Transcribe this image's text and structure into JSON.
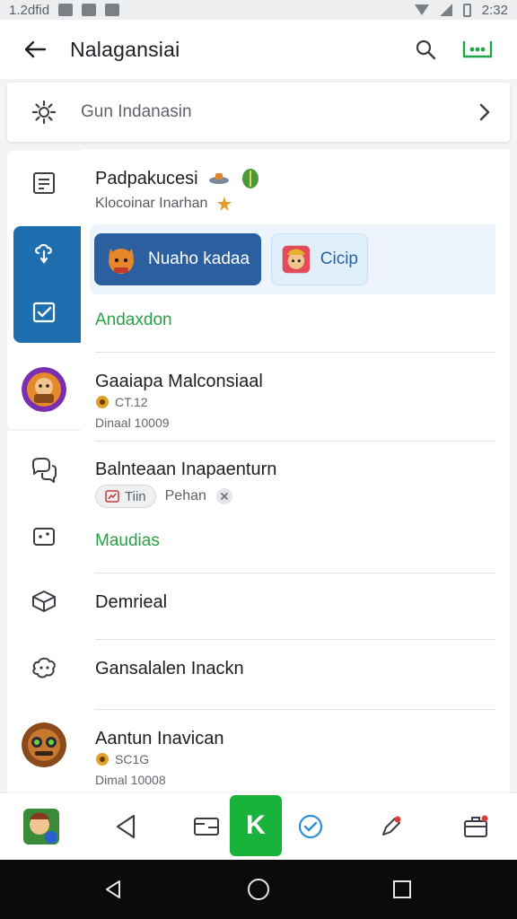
{
  "status_bar": {
    "left_text": "1.2dfid",
    "time": "2:32"
  },
  "app_bar": {
    "title": "Nalagansiai",
    "back_icon": "arrow-left-icon",
    "search_icon": "search-icon",
    "more_icon": "more-dots-icon",
    "accent": "#1fa64a"
  },
  "search_row": {
    "text": "Gun Indanasin",
    "icon": "gear-icon",
    "chevron": "chevron-right-icon"
  },
  "rail": {
    "items": [
      {
        "icon": "document-icon"
      },
      {
        "icon": "link-cloud-icon",
        "selected": true
      },
      {
        "icon": "checkbox-icon",
        "selected": true
      },
      {
        "icon": "avatar-game"
      },
      {
        "icon": "chat-icon"
      },
      {
        "icon": "dice-icon"
      },
      {
        "icon": "box-icon"
      },
      {
        "icon": "bug-icon"
      },
      {
        "icon": "avatar-bot"
      }
    ],
    "selected_color": "#1f6fb0"
  },
  "sections": {
    "header": {
      "title": "Padpakucesi",
      "subtitle": "Klocoinar Inarhan"
    },
    "chips": [
      {
        "label": "Nuaho kadaa",
        "style": "primary"
      },
      {
        "label": "Cicip",
        "style": "secondary"
      }
    ],
    "link1": "Andaxdon",
    "game1": {
      "title": "Gaaiapa Malconsiaal",
      "stat": "CT.12",
      "meta": "Dinaal 10009"
    },
    "block2": {
      "title": "Balnteaan Inapaenturn",
      "pill": "Tiin",
      "tag": "Pehan"
    },
    "link2": "Maudias",
    "item3": "Demrieal",
    "item4": "Gansalalen Inackn",
    "game2": {
      "title": "Aantun Inavican",
      "stat": "SC1G",
      "meta": "Dimal 10008"
    }
  },
  "bottom_nav": {
    "center_label": "K",
    "center_color": "#19b33c",
    "items": [
      "game-avatar",
      "triangle-back-icon",
      "screen-icon",
      "check-circle-icon",
      "pen-icon",
      "briefcase-icon"
    ]
  }
}
